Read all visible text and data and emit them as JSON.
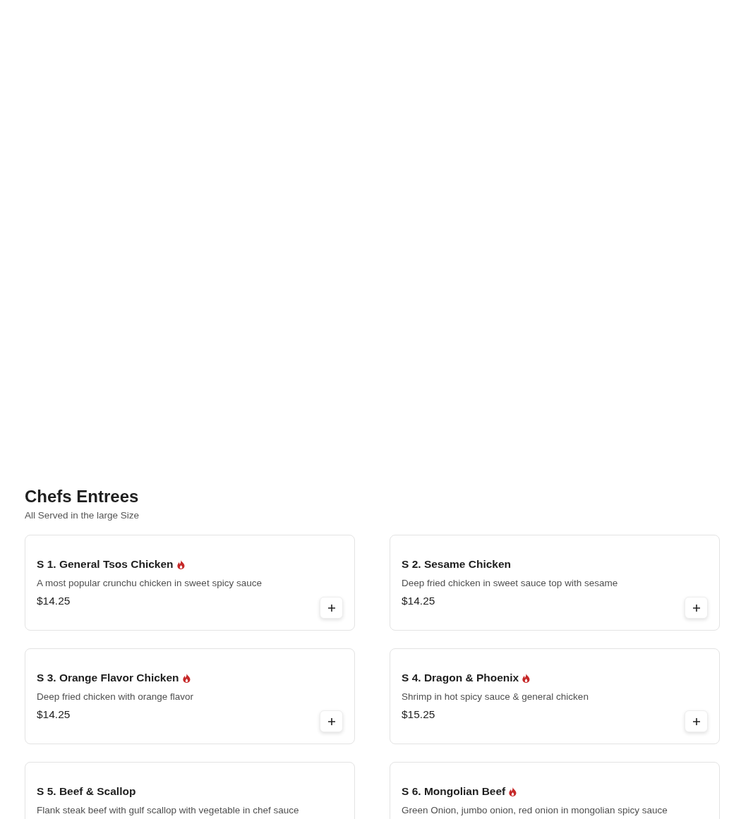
{
  "section": {
    "title": "Chefs Entrees",
    "subtitle": "All Served in the large Size"
  },
  "items": [
    {
      "name": "S 1. General Tsos Chicken",
      "spicy": true,
      "description": "A most popular crunchu chicken in sweet spicy sauce",
      "price": "$14.25"
    },
    {
      "name": "S 2. Sesame Chicken",
      "spicy": false,
      "description": "Deep fried chicken in sweet sauce top with sesame",
      "price": "$14.25"
    },
    {
      "name": "S 3. Orange Flavor Chicken",
      "spicy": true,
      "description": "Deep fried chicken with orange flavor",
      "price": "$14.25"
    },
    {
      "name": "S 4. Dragon & Phoenix",
      "spicy": true,
      "description": "Shrimp in hot spicy sauce & general chicken",
      "price": "$15.25"
    },
    {
      "name": "S 5. Beef & Scallop",
      "spicy": false,
      "description": "Flank steak beef with gulf scallop with vegetable in chef sauce"
    },
    {
      "name": "S 6. Mongolian Beef",
      "spicy": true,
      "description": "Green Onion, jumbo onion, red onion in mongolian spicy sauce"
    }
  ]
}
